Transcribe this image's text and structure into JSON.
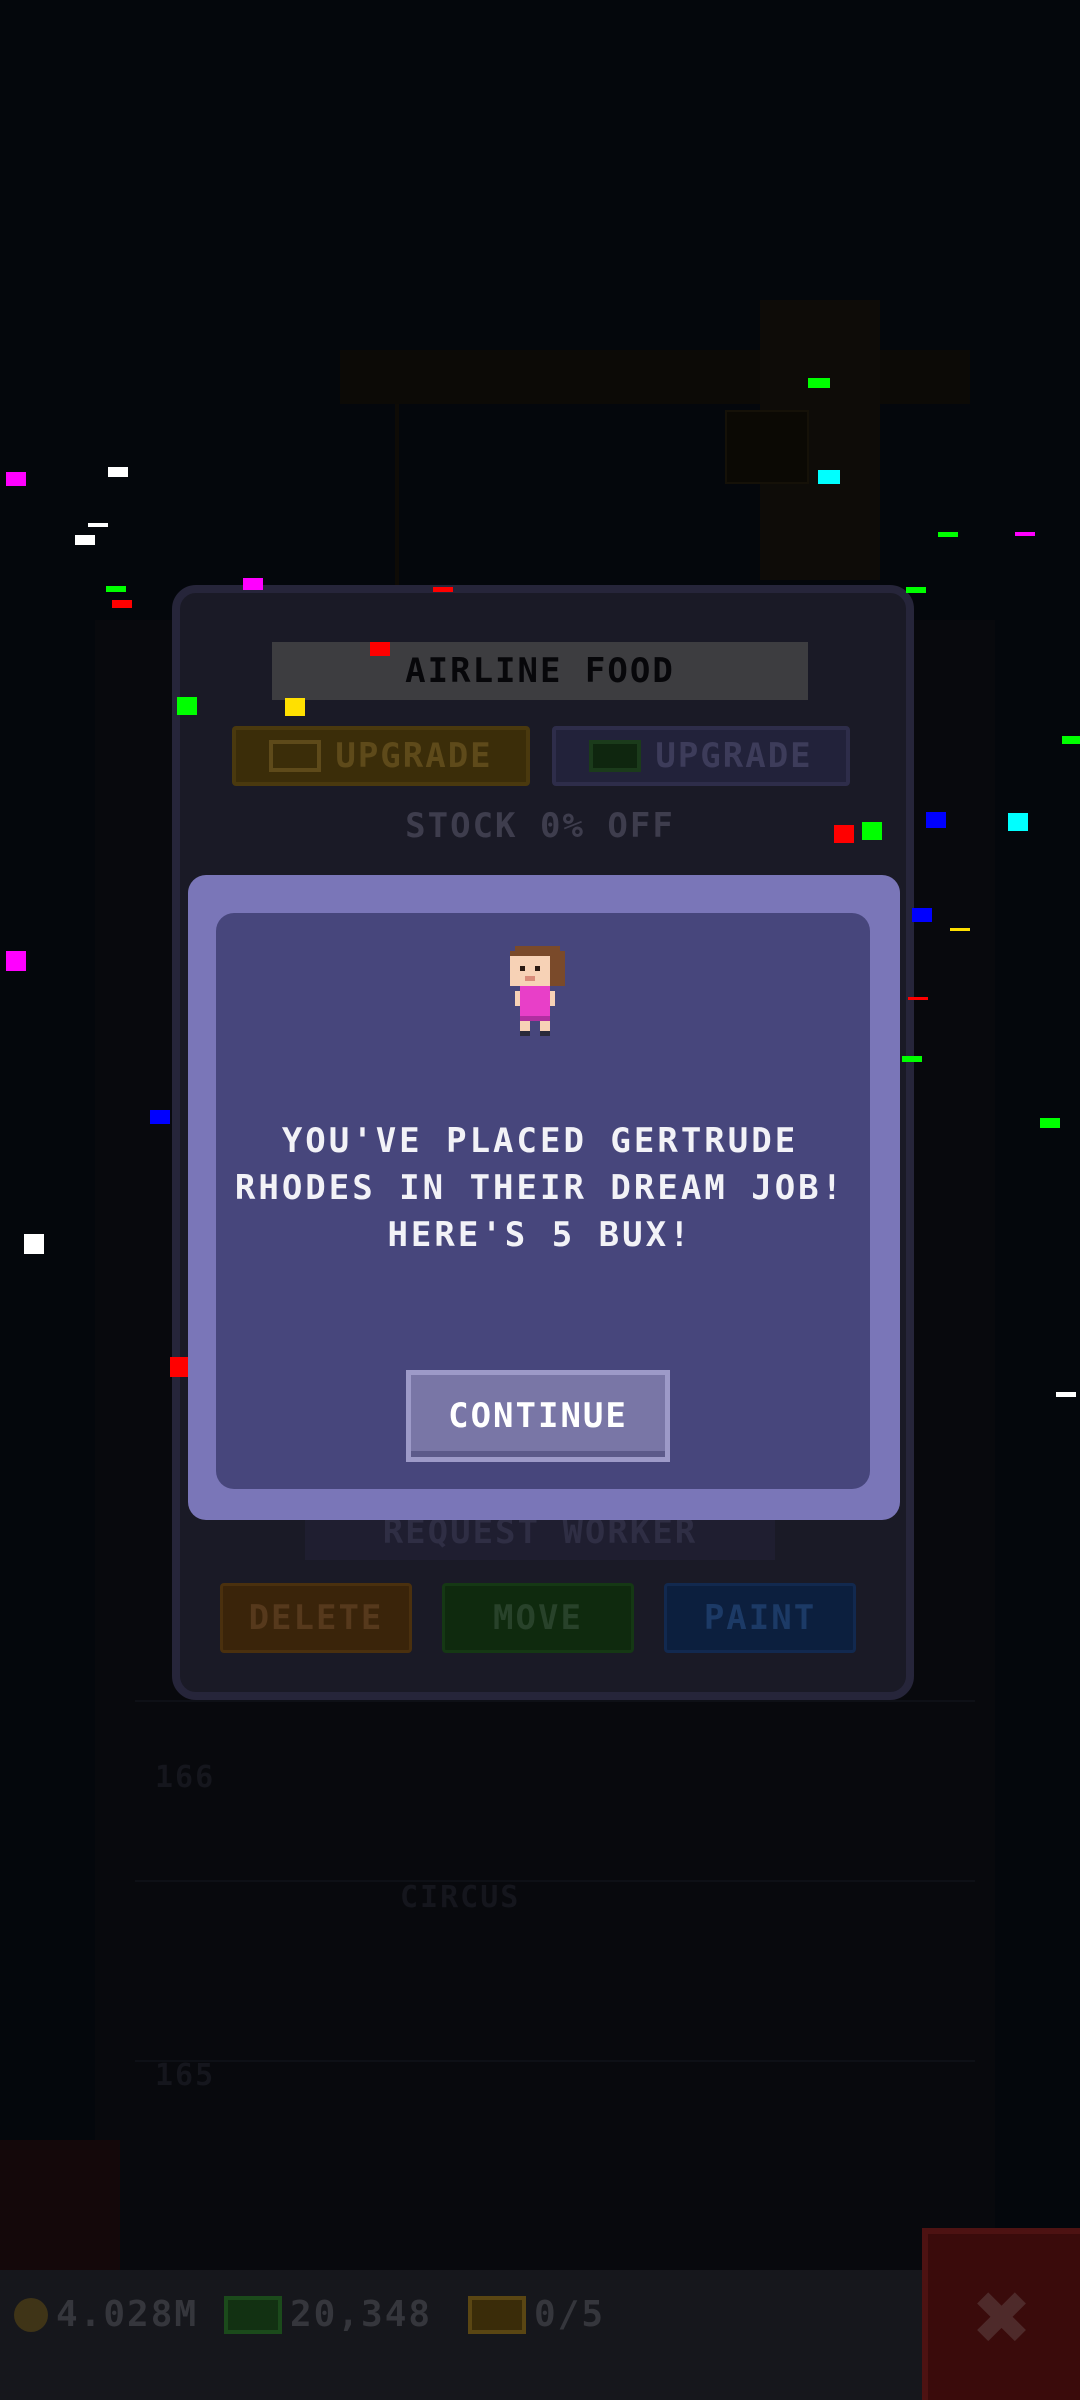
{
  "room": {
    "title": "AIRLINE FOOD",
    "upgrade_coin_label": "UPGRADE",
    "upgrade_bux_label": "UPGRADE",
    "stock_text": "STOCK 0% OFF",
    "request_worker_label": "REQUEST WORKER",
    "delete_label": "DELETE",
    "move_label": "MOVE",
    "paint_label": "PAINT"
  },
  "dialog": {
    "message": "YOU'VE PLACED GERTRUDE RHODES IN THEIR DREAM JOB! HERE'S 5 BUX!",
    "continue_label": "CONTINUE"
  },
  "background_floors": [
    {
      "floor": "166",
      "name": ""
    },
    {
      "floor": "165",
      "name": "CIRCUS"
    }
  ],
  "status_bar": {
    "coins": "4.028M",
    "bux": "20,348",
    "tickets": "0/5"
  },
  "colors": {
    "dialog_frame": "#7a76b8",
    "dialog_body": "#47467c",
    "avatar_shirt": "#e83fc8"
  }
}
